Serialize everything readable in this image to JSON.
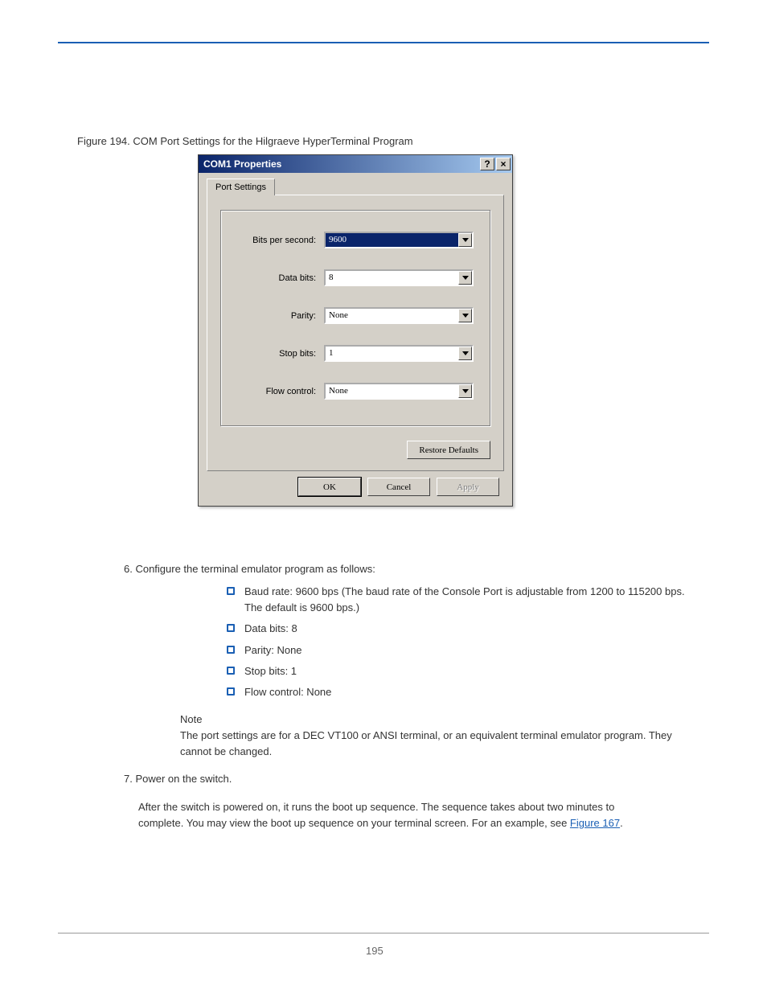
{
  "figure_caption": "Figure 194. COM Port Settings for the Hilgraeve HyperTerminal Program",
  "dialog": {
    "title": "COM1 Properties",
    "help_glyph": "?",
    "close_glyph": "×",
    "tab_label": "Port Settings",
    "fields": {
      "bits_per_second": {
        "label": "Bits per second:",
        "value": "9600"
      },
      "data_bits": {
        "label": "Data bits:",
        "value": "8"
      },
      "parity": {
        "label": "Parity:",
        "value": "None"
      },
      "stop_bits": {
        "label": "Stop bits:",
        "value": "1"
      },
      "flow_control": {
        "label": "Flow control:",
        "value": "None"
      }
    },
    "restore_label": "Restore Defaults",
    "ok_label": "OK",
    "cancel_label": "Cancel",
    "apply_label": "Apply"
  },
  "step_intro": "6. Configure the terminal emulator program as follows:",
  "settings_list": [
    "Baud rate: 9600 bps (The baud rate of the Console Port is adjustable from 1200 to 115200 bps. The default is 9600 bps.)",
    "Data bits: 8",
    "Parity: None",
    "Stop bits: 1",
    "Flow control: None"
  ],
  "note_heading": "Note",
  "note_body": "The port settings are for a DEC VT100 or ANSI terminal, or an equivalent terminal emulator program. They cannot be changed.",
  "step7": "7. Power on the switch.",
  "step8a": "After the switch is powered on, it runs the boot up sequence. The sequence takes about two minutes to complete. You may view the boot up sequence on your terminal screen. For an example, see ",
  "step8b_link": "Figure 167",
  "step8c": ".",
  "page_number": "195"
}
